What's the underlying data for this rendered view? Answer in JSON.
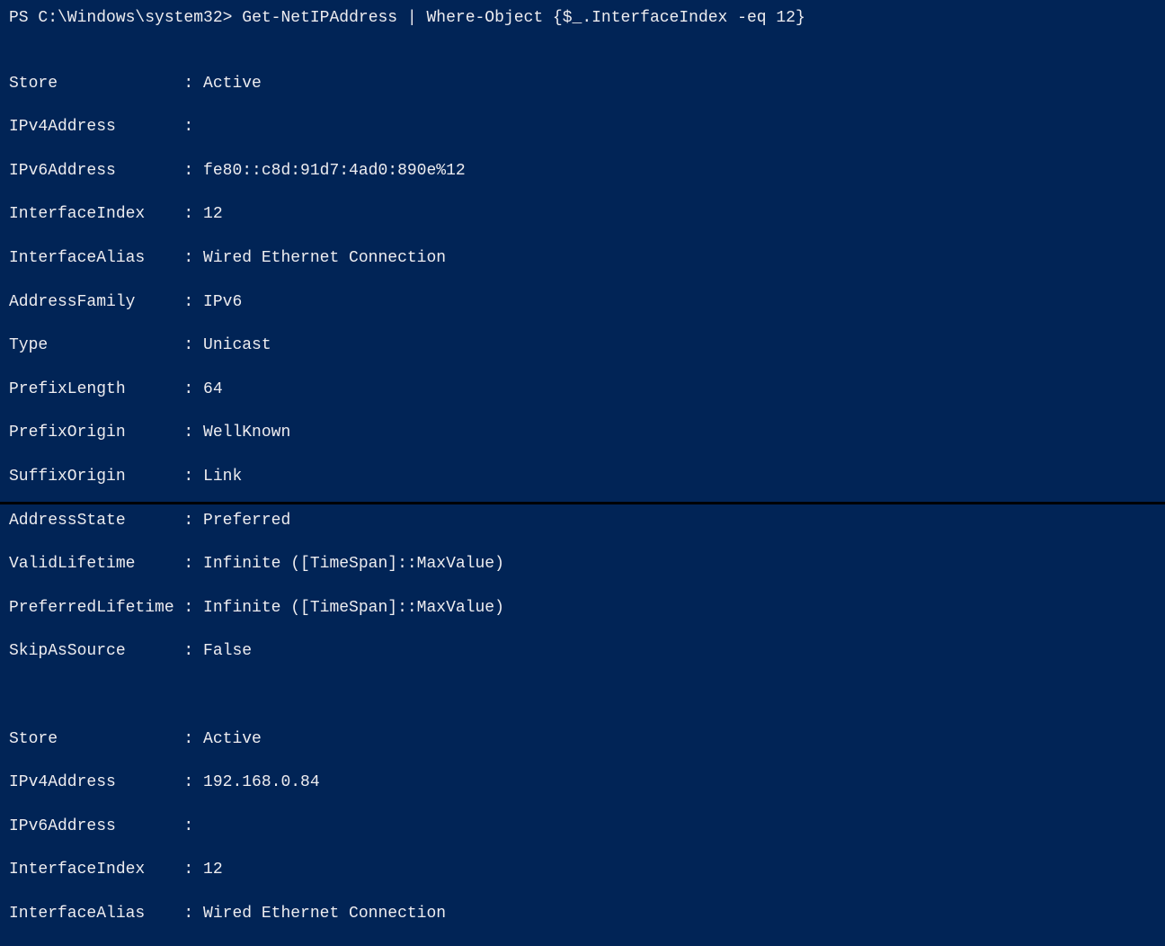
{
  "prompt": {
    "prefix": "PS C:\\Windows\\system32>",
    "command": "Get-NetIPAddress | Where-Object {$_.InterfaceIndex -eq 12}"
  },
  "blocks": [
    {
      "rows": [
        {
          "key": "Store",
          "value": "Active"
        },
        {
          "key": "IPv4Address",
          "value": ""
        },
        {
          "key": "IPv6Address",
          "value": "fe80::c8d:91d7:4ad0:890e%12"
        },
        {
          "key": "InterfaceIndex",
          "value": "12"
        },
        {
          "key": "InterfaceAlias",
          "value": "Wired Ethernet Connection"
        },
        {
          "key": "AddressFamily",
          "value": "IPv6"
        },
        {
          "key": "Type",
          "value": "Unicast"
        },
        {
          "key": "PrefixLength",
          "value": "64"
        },
        {
          "key": "PrefixOrigin",
          "value": "WellKnown"
        },
        {
          "key": "SuffixOrigin",
          "value": "Link"
        },
        {
          "key": "AddressState",
          "value": "Preferred"
        },
        {
          "key": "ValidLifetime",
          "value": "Infinite ([TimeSpan]::MaxValue)"
        },
        {
          "key": "PreferredLifetime",
          "value": "Infinite ([TimeSpan]::MaxValue)"
        },
        {
          "key": "SkipAsSource",
          "value": "False"
        }
      ]
    },
    {
      "rows": [
        {
          "key": "Store",
          "value": "Active"
        },
        {
          "key": "IPv4Address",
          "value": "192.168.0.84"
        },
        {
          "key": "IPv6Address",
          "value": ""
        },
        {
          "key": "InterfaceIndex",
          "value": "12"
        },
        {
          "key": "InterfaceAlias",
          "value": "Wired Ethernet Connection"
        }
      ]
    }
  ]
}
